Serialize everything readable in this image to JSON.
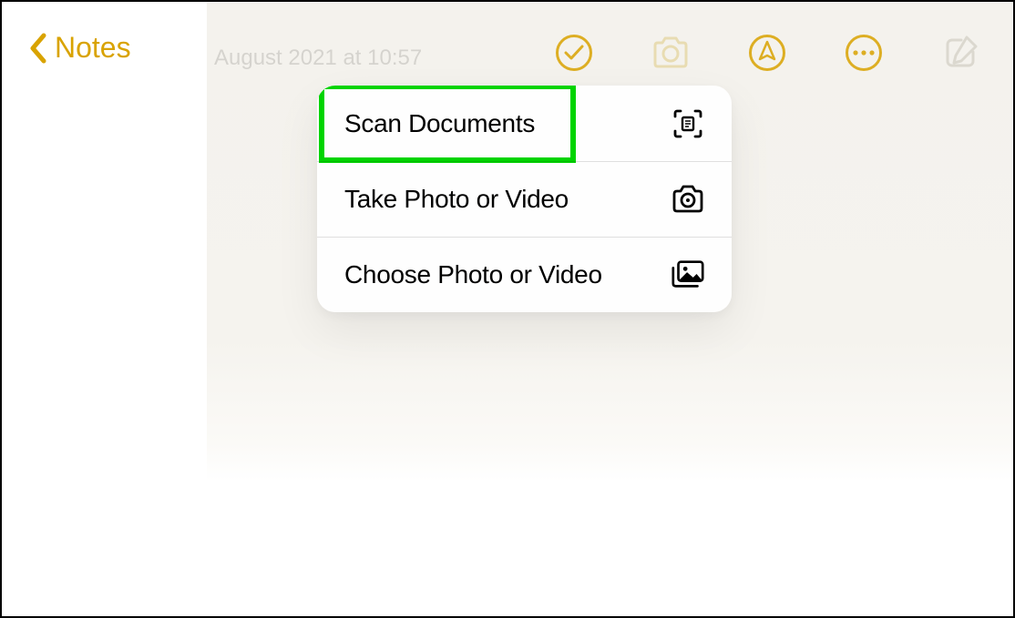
{
  "header": {
    "back_label": "Notes"
  },
  "note": {
    "date_text": "August 2021 at 10:57"
  },
  "popup": {
    "items": [
      {
        "label": "Scan Documents",
        "icon": "scan-document-icon",
        "highlighted": true
      },
      {
        "label": "Take Photo or Video",
        "icon": "camera-icon",
        "highlighted": false
      },
      {
        "label": "Choose Photo or Video",
        "icon": "photo-library-icon",
        "highlighted": false
      }
    ]
  }
}
